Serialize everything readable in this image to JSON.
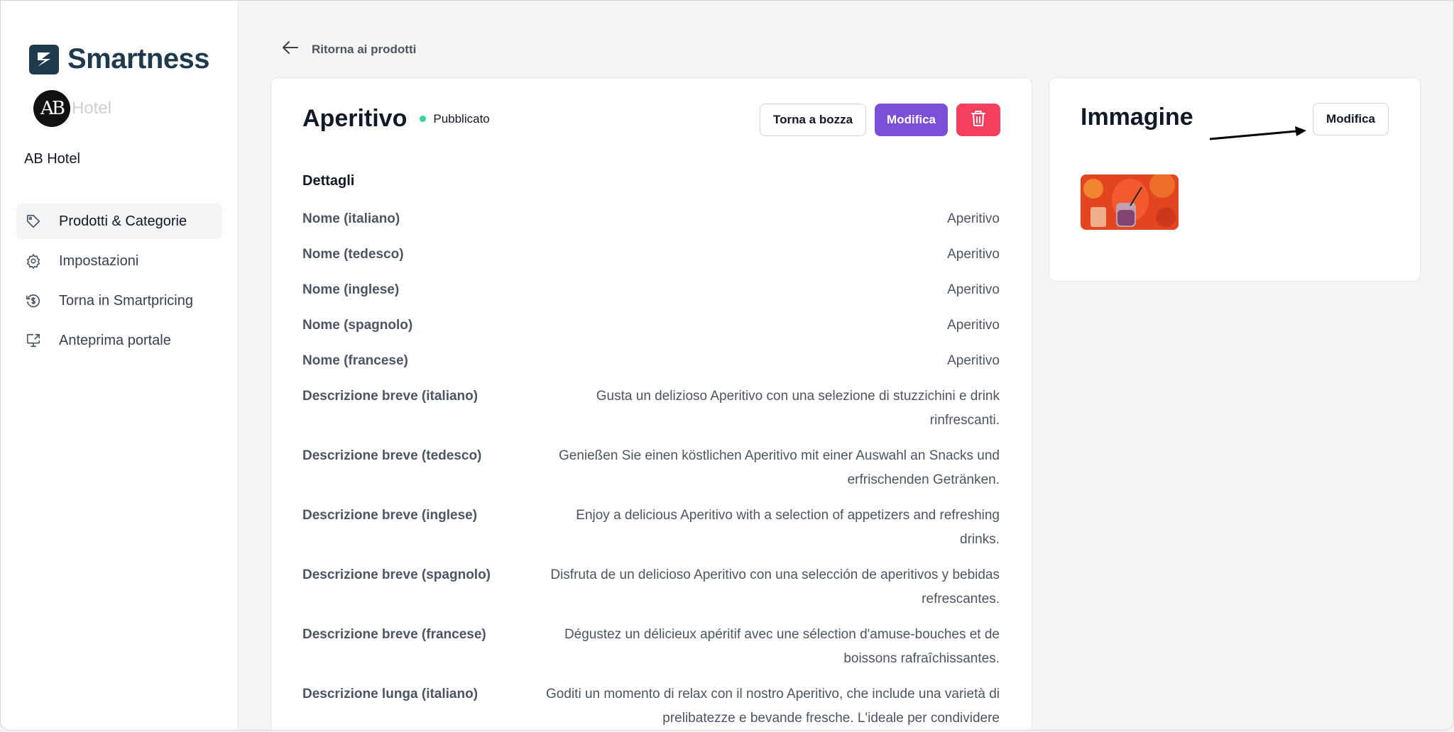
{
  "sidebar": {
    "brand": "Smartness",
    "hotel_logo_initials": "AB",
    "hotel_logo_word": "Hotel",
    "hotel_name": "AB Hotel",
    "nav": [
      {
        "label": "Prodotti & Categorie",
        "icon": "tag-icon",
        "active": true
      },
      {
        "label": "Impostazioni",
        "icon": "gear-icon",
        "active": false
      },
      {
        "label": "Torna in Smartpricing",
        "icon": "dollar-refresh-icon",
        "active": false
      },
      {
        "label": "Anteprima portale",
        "icon": "monitor-share-icon",
        "active": false
      }
    ]
  },
  "back_link": "Ritorna ai prodotti",
  "product": {
    "title": "Aperitivo",
    "status": "Pubblicato",
    "status_color": "#34d399",
    "actions": {
      "draft": "Torna a bozza",
      "edit": "Modifica"
    },
    "section_title": "Dettagli",
    "rows": [
      {
        "label": "Nome (italiano)",
        "value": "Aperitivo"
      },
      {
        "label": "Nome (tedesco)",
        "value": "Aperitivo"
      },
      {
        "label": "Nome (inglese)",
        "value": "Aperitivo"
      },
      {
        "label": "Nome (spagnolo)",
        "value": "Aperitivo"
      },
      {
        "label": "Nome (francese)",
        "value": "Aperitivo"
      },
      {
        "label": "Descrizione breve (italiano)",
        "value": "Gusta un delizioso Aperitivo con una selezione di stuzzichini e drink rinfrescanti."
      },
      {
        "label": "Descrizione breve (tedesco)",
        "value": "Genießen Sie einen köstlichen Aperitivo mit einer Auswahl an Snacks und erfrischenden Getränken."
      },
      {
        "label": "Descrizione breve (inglese)",
        "value": "Enjoy a delicious Aperitivo with a selection of appetizers and refreshing drinks."
      },
      {
        "label": "Descrizione breve (spagnolo)",
        "value": "Disfruta de un delicioso Aperitivo con una selección de aperitivos y bebidas refrescantes."
      },
      {
        "label": "Descrizione breve (francese)",
        "value": "Dégustez un délicieux apéritif avec une sélection d'amuse-bouches et de boissons rafraîchissantes."
      },
      {
        "label": "Descrizione lunga (italiano)",
        "value": "Goditi un momento di relax con il nostro Aperitivo, che include una varietà di prelibatezze e bevande fresche. L'ideale per condividere"
      }
    ]
  },
  "image_panel": {
    "title": "Immagine",
    "edit": "Modifica"
  },
  "colors": {
    "accent": "#7b4fd6",
    "danger": "#f43f5e",
    "brand": "#1e3a4c"
  }
}
